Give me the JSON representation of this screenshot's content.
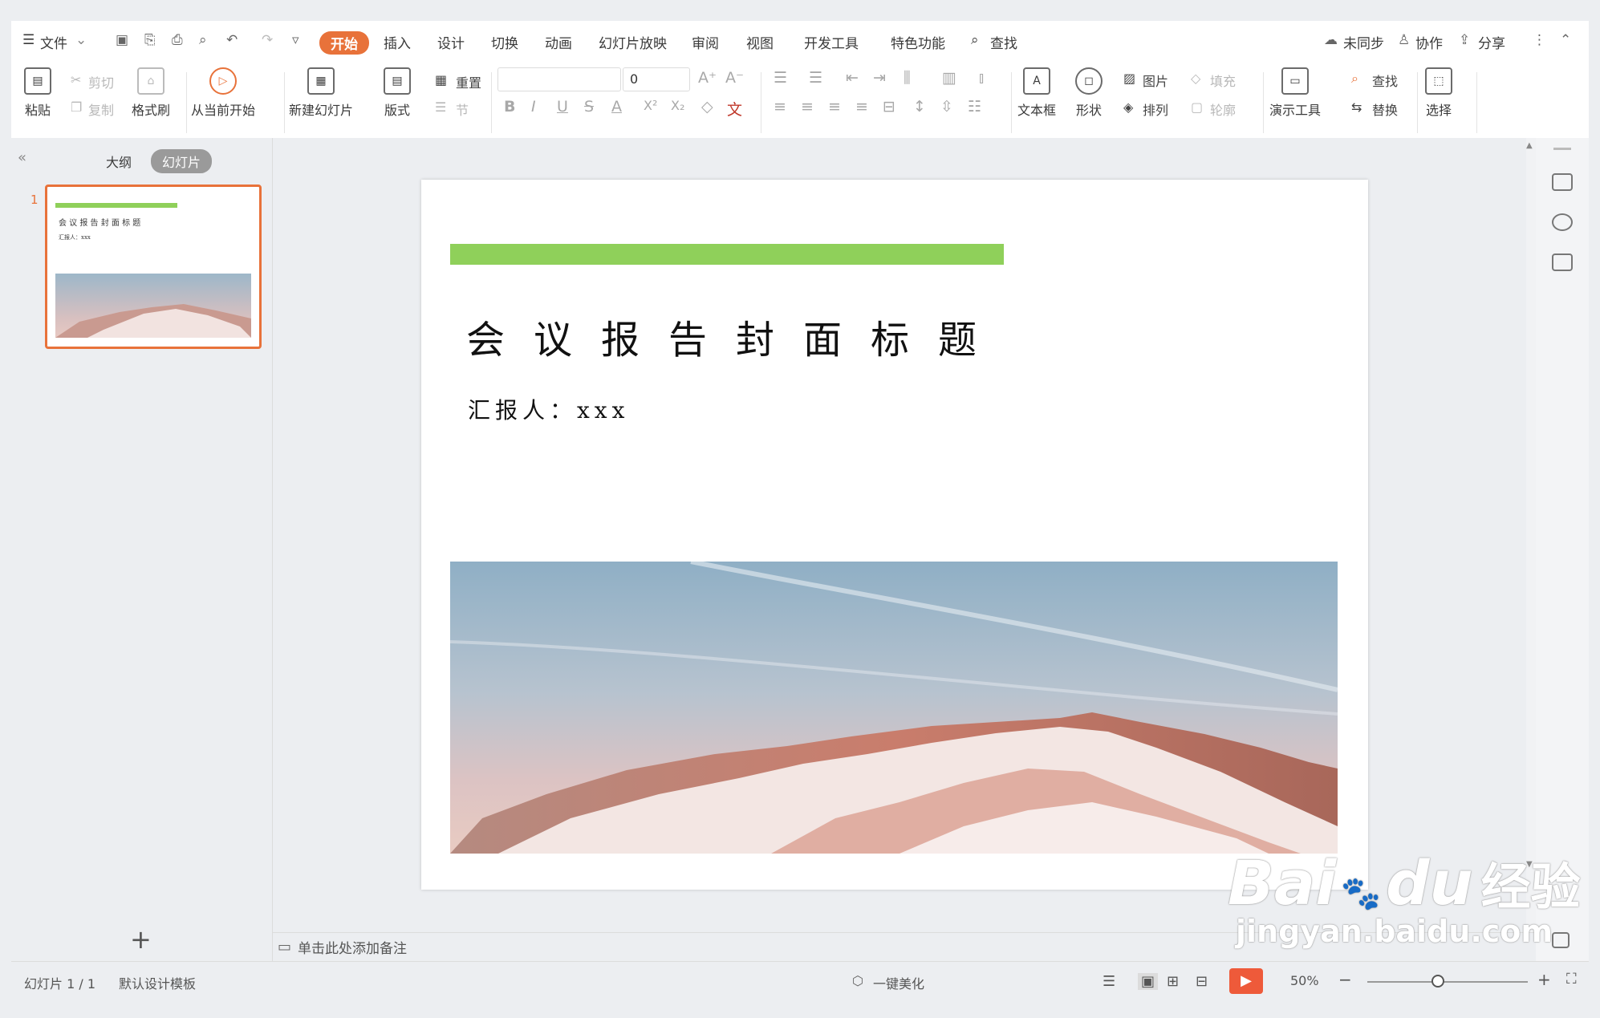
{
  "menu": {
    "file": "文件",
    "tabs": [
      "开始",
      "插入",
      "设计",
      "切换",
      "动画",
      "幻灯片放映",
      "审阅",
      "视图",
      "开发工具",
      "特色功能"
    ],
    "search": "查找",
    "right": {
      "sync": "未同步",
      "collab": "协作",
      "share": "分享"
    }
  },
  "ribbon": {
    "paste": "粘贴",
    "cut": "剪切",
    "copy": "复制",
    "format_painter": "格式刷",
    "from_current": "从当前开始",
    "new_slide": "新建幻灯片",
    "layout": "版式",
    "reset": "重置",
    "section": "节",
    "font_size": "0",
    "textbox": "文本框",
    "shape": "形状",
    "picture": "图片",
    "fill": "填充",
    "arrange": "排列",
    "outline": "轮廓",
    "present_tools": "演示工具",
    "find": "查找",
    "replace": "替换",
    "select": "选择",
    "fmt": {
      "bold": "B",
      "italic": "I",
      "underline": "U",
      "strike": "S",
      "fontcolor": "A",
      "sup": "X²",
      "sub": "X₂",
      "clear": "◇",
      "phonetic": "文"
    }
  },
  "panel": {
    "outline_tab": "大纲",
    "slides_tab": "幻灯片",
    "slide_no": "1",
    "add": "+"
  },
  "slide": {
    "title": "会议报告封面标题",
    "reporter": "汇报人：xxx",
    "thumb_title": "会 议 报 告 封 面 标 题",
    "thumb_sub": "汇报人：xxx"
  },
  "notes": {
    "placeholder": "单击此处添加备注"
  },
  "status": {
    "slide_count": "幻灯片 1 / 1",
    "template": "默认设计模板",
    "beautify": "一键美化",
    "zoom": "50%"
  },
  "colors": {
    "accent": "#e8723a",
    "green_bar": "#8fd05a"
  },
  "watermark": {
    "brand": "Bai",
    "brand2": "du",
    "cn": "经验",
    "url": "jingyan.baidu.com"
  }
}
